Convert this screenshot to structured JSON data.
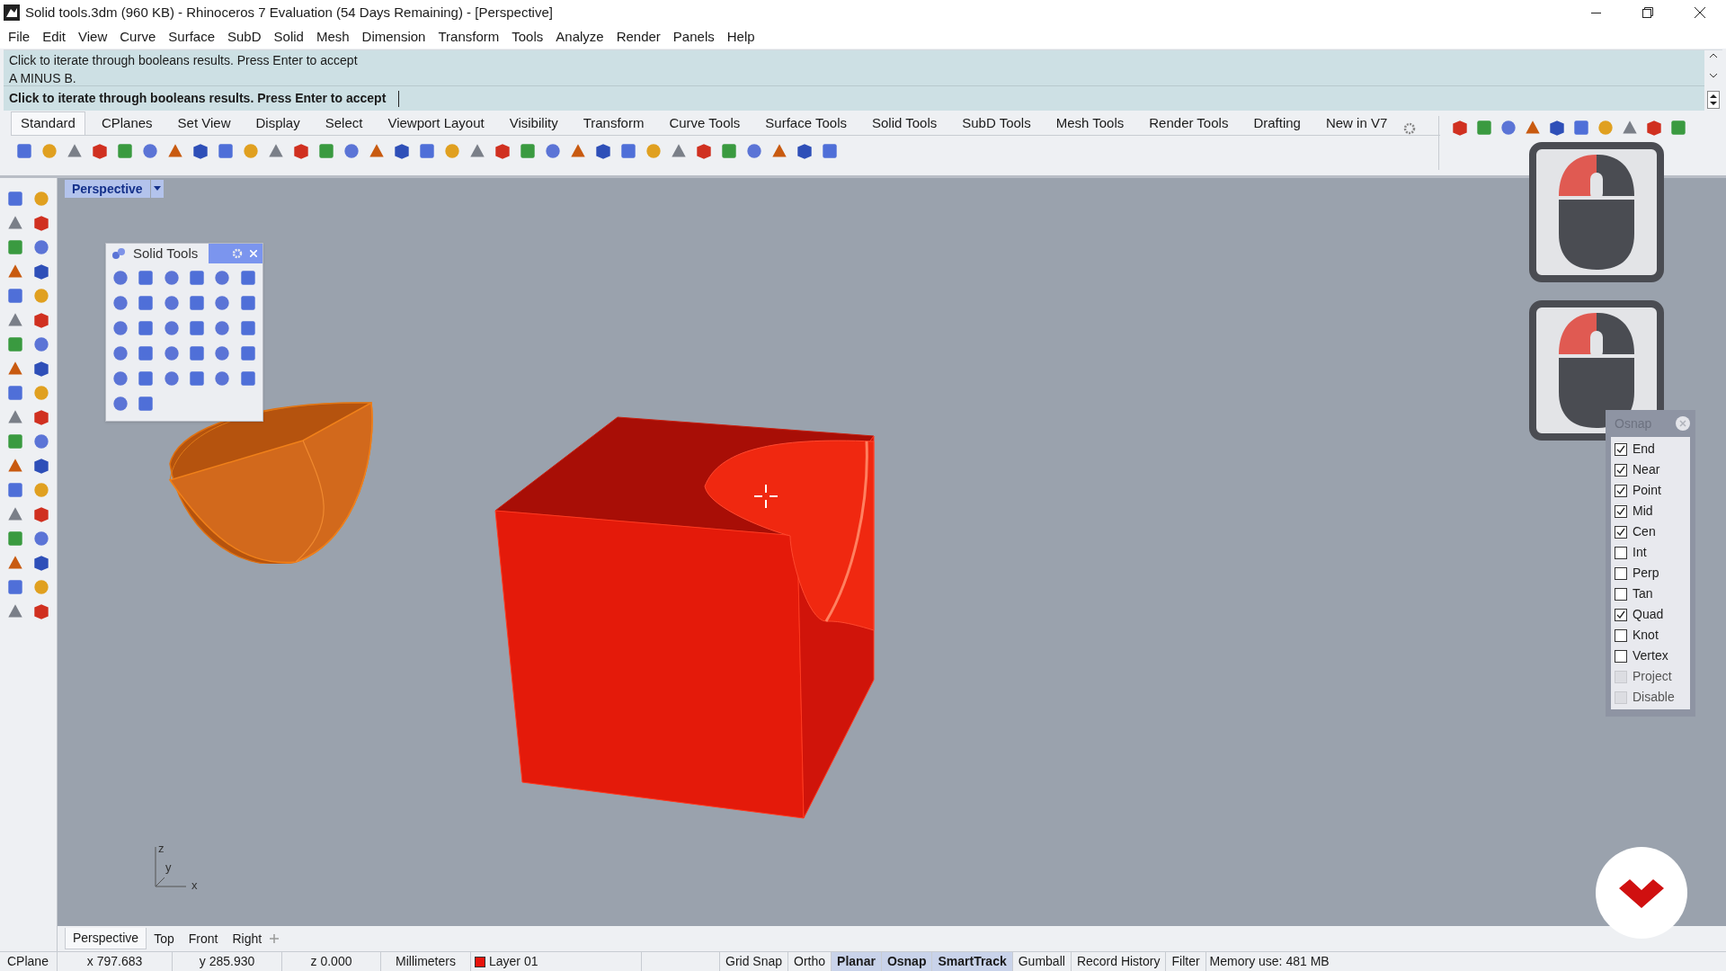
{
  "window": {
    "title": "Solid tools.3dm (960 KB) - Rhinoceros 7 Evaluation (54 Days Remaining) - [Perspective]"
  },
  "menu": [
    "File",
    "Edit",
    "View",
    "Curve",
    "Surface",
    "SubD",
    "Solid",
    "Mesh",
    "Dimension",
    "Transform",
    "Tools",
    "Analyze",
    "Render",
    "Panels",
    "Help"
  ],
  "command": {
    "history": [
      "Click to iterate through booleans results. Press Enter to accept",
      "A MINUS B."
    ],
    "prompt": "Click to iterate through booleans results. Press Enter to accept"
  },
  "toolbar_tabs": [
    {
      "label": "Standard",
      "selected": true
    },
    {
      "label": "CPlanes",
      "selected": false
    },
    {
      "label": "Set View",
      "selected": false
    },
    {
      "label": "Display",
      "selected": false
    },
    {
      "label": "Select",
      "selected": false
    },
    {
      "label": "Viewport Layout",
      "selected": false
    },
    {
      "label": "Visibility",
      "selected": false
    },
    {
      "label": "Transform",
      "selected": false
    },
    {
      "label": "Curve Tools",
      "selected": false
    },
    {
      "label": "Surface Tools",
      "selected": false
    },
    {
      "label": "Solid Tools",
      "selected": false
    },
    {
      "label": "SubD Tools",
      "selected": false
    },
    {
      "label": "Mesh Tools",
      "selected": false
    },
    {
      "label": "Render Tools",
      "selected": false
    },
    {
      "label": "Drafting",
      "selected": false
    },
    {
      "label": "New in V7",
      "selected": false
    }
  ],
  "viewport": {
    "title": "Perspective",
    "axis_labels": [
      "z",
      "y",
      "x"
    ]
  },
  "solid_tools_panel": {
    "title": "Solid Tools"
  },
  "osnap": {
    "title": "Osnap",
    "items": [
      {
        "label": "End",
        "checked": true,
        "disabled": false
      },
      {
        "label": "Near",
        "checked": true,
        "disabled": false
      },
      {
        "label": "Point",
        "checked": true,
        "disabled": false
      },
      {
        "label": "Mid",
        "checked": true,
        "disabled": false
      },
      {
        "label": "Cen",
        "checked": true,
        "disabled": false
      },
      {
        "label": "Int",
        "checked": false,
        "disabled": false
      },
      {
        "label": "Perp",
        "checked": false,
        "disabled": false
      },
      {
        "label": "Tan",
        "checked": false,
        "disabled": false
      },
      {
        "label": "Quad",
        "checked": true,
        "disabled": false
      },
      {
        "label": "Knot",
        "checked": false,
        "disabled": false
      },
      {
        "label": "Vertex",
        "checked": false,
        "disabled": false
      },
      {
        "label": "Project",
        "checked": false,
        "disabled": true
      },
      {
        "label": "Disable",
        "checked": false,
        "disabled": true
      }
    ]
  },
  "viewport_tabs": [
    {
      "label": "Perspective",
      "selected": true
    },
    {
      "label": "Top",
      "selected": false
    },
    {
      "label": "Front",
      "selected": false
    },
    {
      "label": "Right",
      "selected": false
    }
  ],
  "status_bar": {
    "cplane": "CPlane",
    "x": "x 797.683",
    "y": "y 285.930",
    "z": "z 0.000",
    "units": "Millimeters",
    "layer": {
      "name": "Layer 01",
      "color": "#e8140c"
    },
    "toggles": [
      {
        "label": "Grid Snap",
        "on": false
      },
      {
        "label": "Ortho",
        "on": false
      },
      {
        "label": "Planar",
        "on": true
      },
      {
        "label": "Osnap",
        "on": true
      },
      {
        "label": "SmartTrack",
        "on": true
      },
      {
        "label": "Gumball",
        "on": false
      },
      {
        "label": "Record History",
        "on": false
      },
      {
        "label": "Filter",
        "on": false
      }
    ],
    "memory": "Memory use: 481 MB"
  }
}
